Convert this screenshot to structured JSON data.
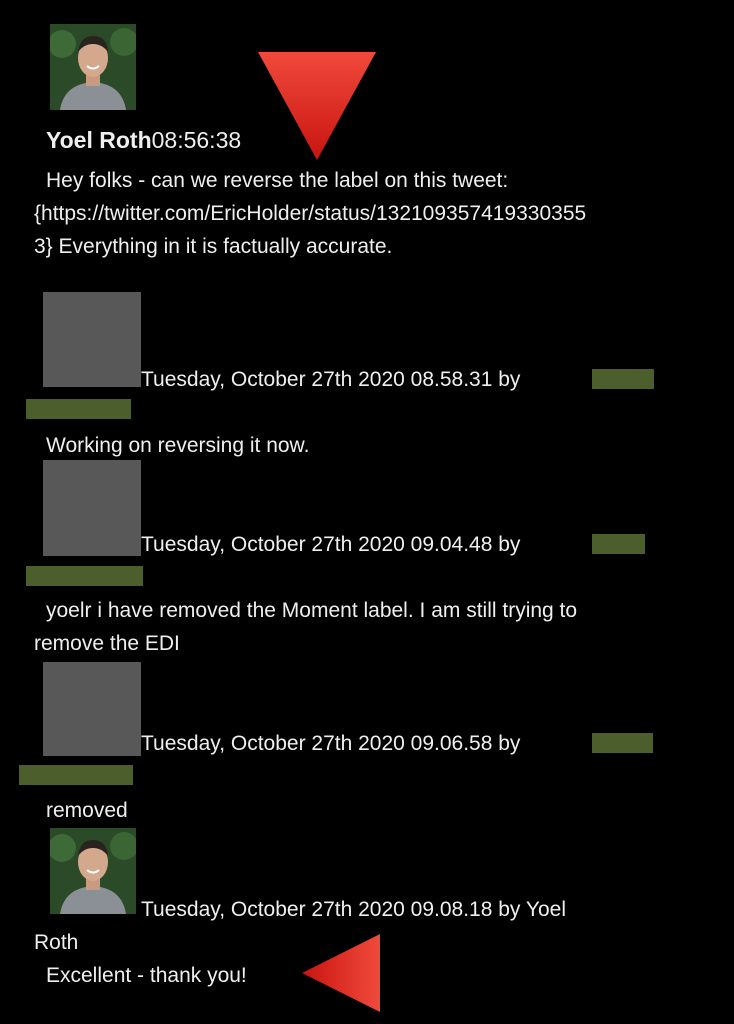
{
  "messages": [
    {
      "author": "Yoel Roth",
      "time": "08:56:38",
      "text_line1": "Hey folks - can we reverse the label on this tweet:",
      "text_line2": "{https://twitter.com/EricHolder/status/132109357419330355",
      "text_line3": "3} Everything in it is factually accurate."
    },
    {
      "timestamp": "Tuesday, October 27th 2020 08.58.31 by",
      "text": "Working on reversing it now."
    },
    {
      "timestamp": "Tuesday, October 27th 2020 09.04.48 by",
      "text_line1": "yoelr i have removed the Moment label. I am still trying to",
      "text_line2": "remove the EDI"
    },
    {
      "timestamp": "Tuesday, October 27th 2020 09.06.58 by",
      "text": "removed"
    },
    {
      "timestamp": "Tuesday, October 27th 2020 09.08.18 by Yoel",
      "timestamp_cont": "Roth",
      "text": "Excellent - thank you!"
    }
  ],
  "colors": {
    "background": "#000000",
    "text": "#efefef",
    "redaction": "#4c5e2b",
    "placeholder_avatar": "#585858",
    "arrow_red": "#e0201c"
  },
  "icons": {
    "annotation_down": "red-down-arrow-icon",
    "annotation_left": "red-left-arrow-icon"
  }
}
